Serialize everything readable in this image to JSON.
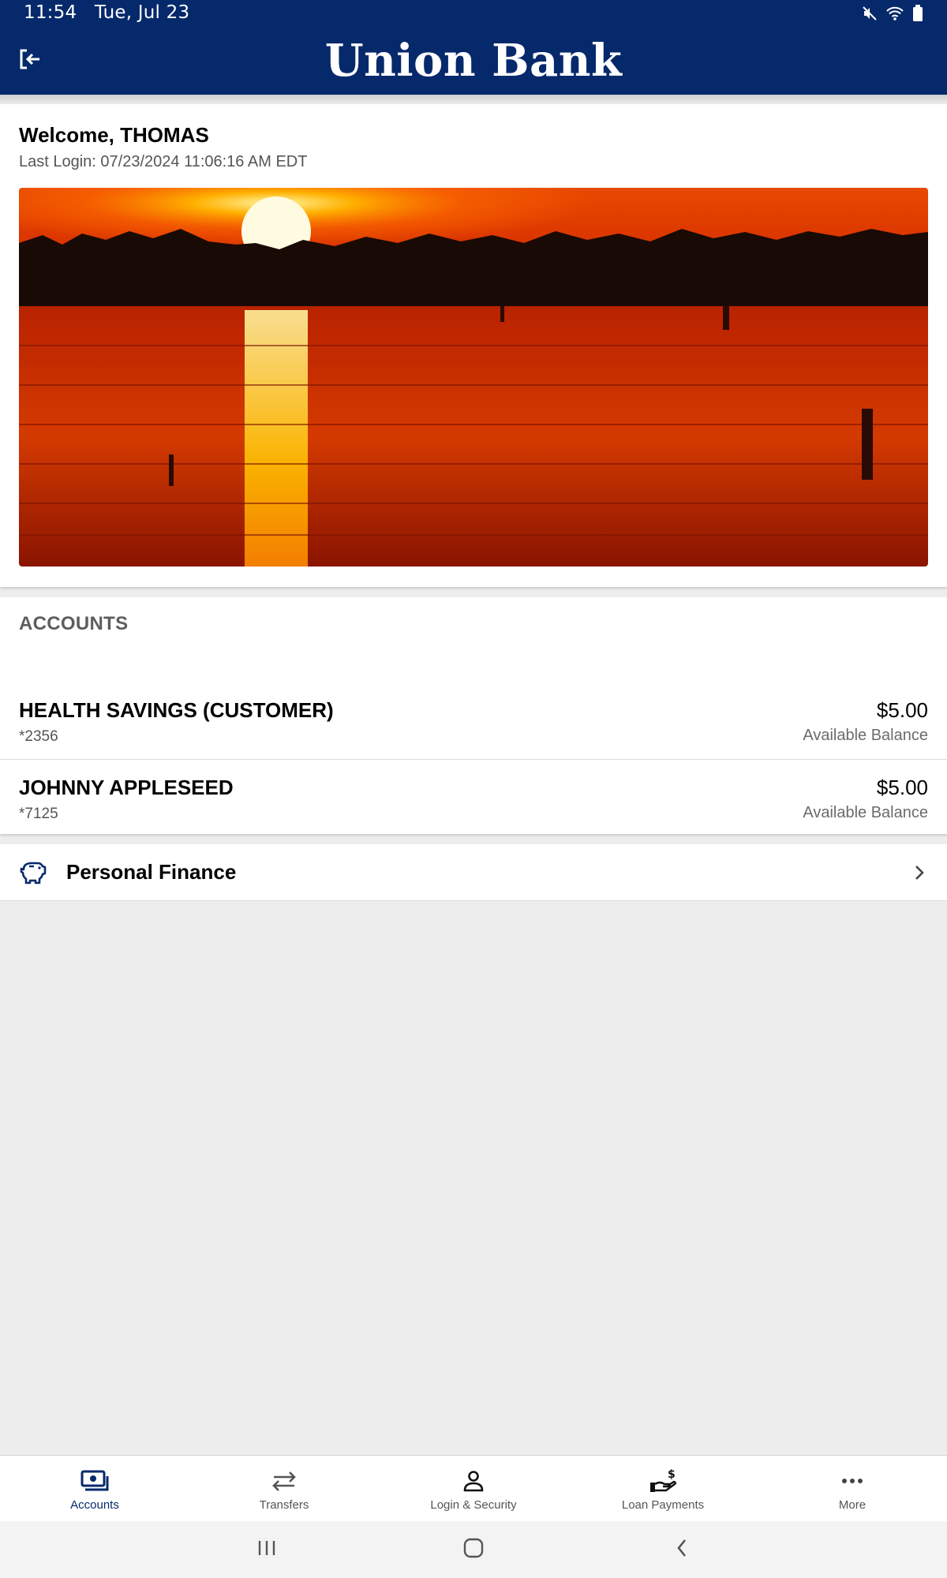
{
  "status_bar": {
    "time": "11:54",
    "date": "Tue, Jul 23",
    "icons": [
      "mute-icon",
      "wifi-icon",
      "battery-icon"
    ]
  },
  "header": {
    "brand": "Union Bank",
    "logout_icon": "logout-icon",
    "background_color": "#06296b"
  },
  "welcome": {
    "title": "Welcome, THOMAS",
    "last_login": "Last Login: 07/23/2024 11:06:16 AM EDT"
  },
  "accounts": {
    "heading": "ACCOUNTS",
    "items": [
      {
        "name": "HEALTH SAVINGS (CUSTOMER)",
        "number": "*2356",
        "balance": "$5.00",
        "balance_label": "Available Balance"
      },
      {
        "name": "JOHNNY APPLESEED",
        "number": "*7125",
        "balance": "$5.00",
        "balance_label": "Available Balance"
      }
    ]
  },
  "personal_finance": {
    "label": "Personal Finance",
    "icon": "piggy-bank-icon"
  },
  "bottom_nav": {
    "active_color": "#06296b",
    "items": [
      {
        "label": "Accounts",
        "icon": "accounts-icon",
        "active": true
      },
      {
        "label": "Transfers",
        "icon": "transfer-arrows-icon",
        "active": false
      },
      {
        "label": "Login & Security",
        "icon": "person-icon",
        "active": false
      },
      {
        "label": "Loan Payments",
        "icon": "loan-payment-icon",
        "active": false
      },
      {
        "label": "More",
        "icon": "more-dots-icon",
        "active": false
      }
    ]
  },
  "system_nav": {
    "icons": [
      "recent-apps-icon",
      "home-icon",
      "back-icon"
    ]
  }
}
